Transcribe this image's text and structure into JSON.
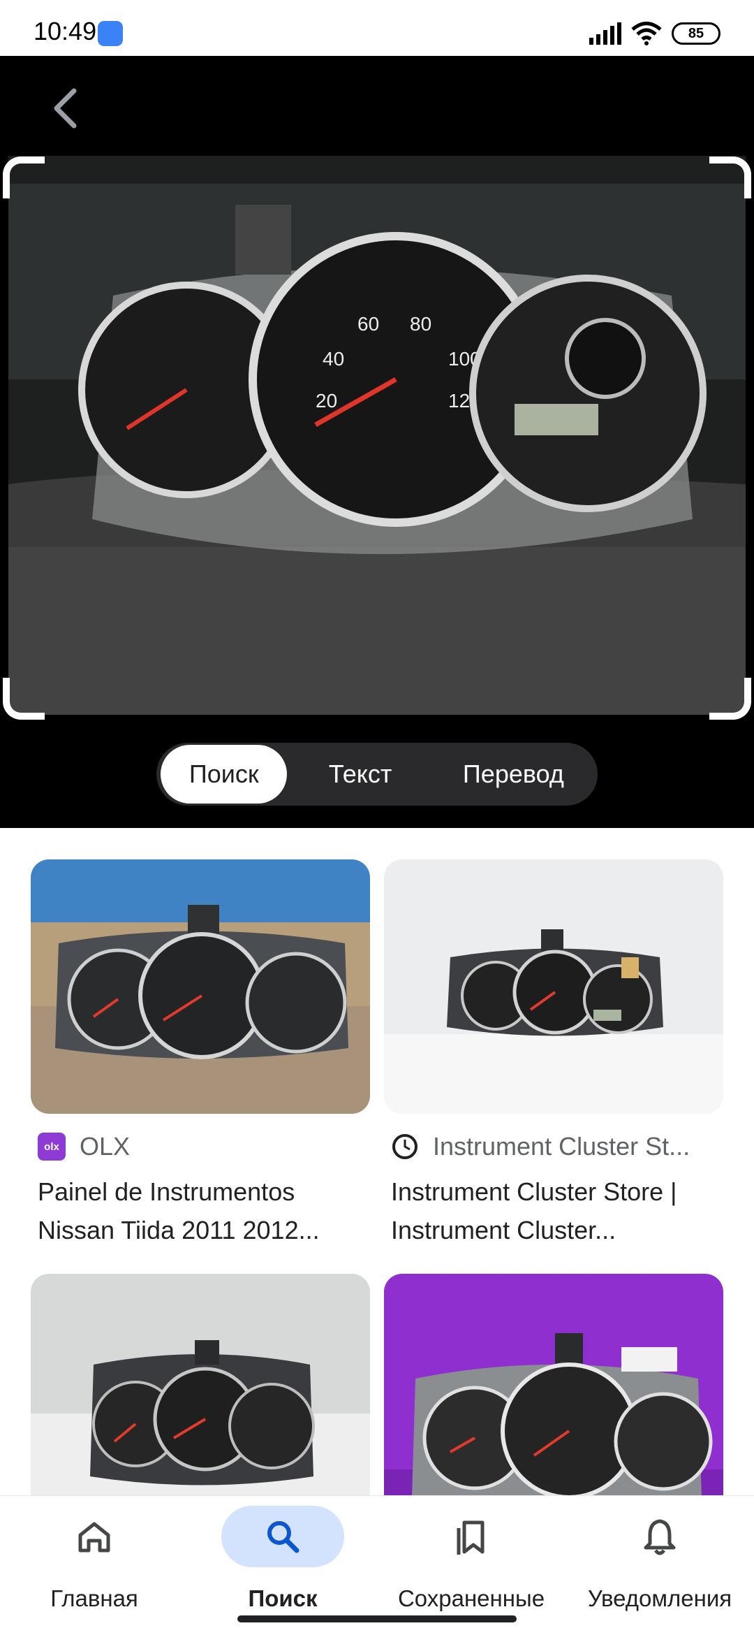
{
  "status_bar": {
    "time": "10:49",
    "battery": "85"
  },
  "viewer": {
    "modes": [
      {
        "label": "Поиск",
        "active": true
      },
      {
        "label": "Текст",
        "active": false
      },
      {
        "label": "Перевод",
        "active": false
      }
    ]
  },
  "results": [
    {
      "source": "OLX",
      "source_icon": "olx-logo-icon",
      "title": "Painel de Instrumentos Nissan Tiida 2011 2012..."
    },
    {
      "source": "Instrument Cluster St...",
      "source_icon": "clock-icon",
      "title": "Instrument Cluster Store | Instrument Cluster..."
    },
    {
      "source": "",
      "title": ""
    },
    {
      "source": "",
      "title": ""
    }
  ],
  "bottom_nav": [
    {
      "label": "Главная",
      "icon": "home-icon",
      "active": false
    },
    {
      "label": "Поиск",
      "icon": "search-icon",
      "active": true
    },
    {
      "label": "Сохраненные",
      "icon": "bookmarks-icon",
      "active": false
    },
    {
      "label": "Уведомления",
      "icon": "bell-icon",
      "active": false
    }
  ],
  "colors": {
    "accent_pill": "#d3e3fd",
    "olx_brand": "#8e3bd6"
  }
}
